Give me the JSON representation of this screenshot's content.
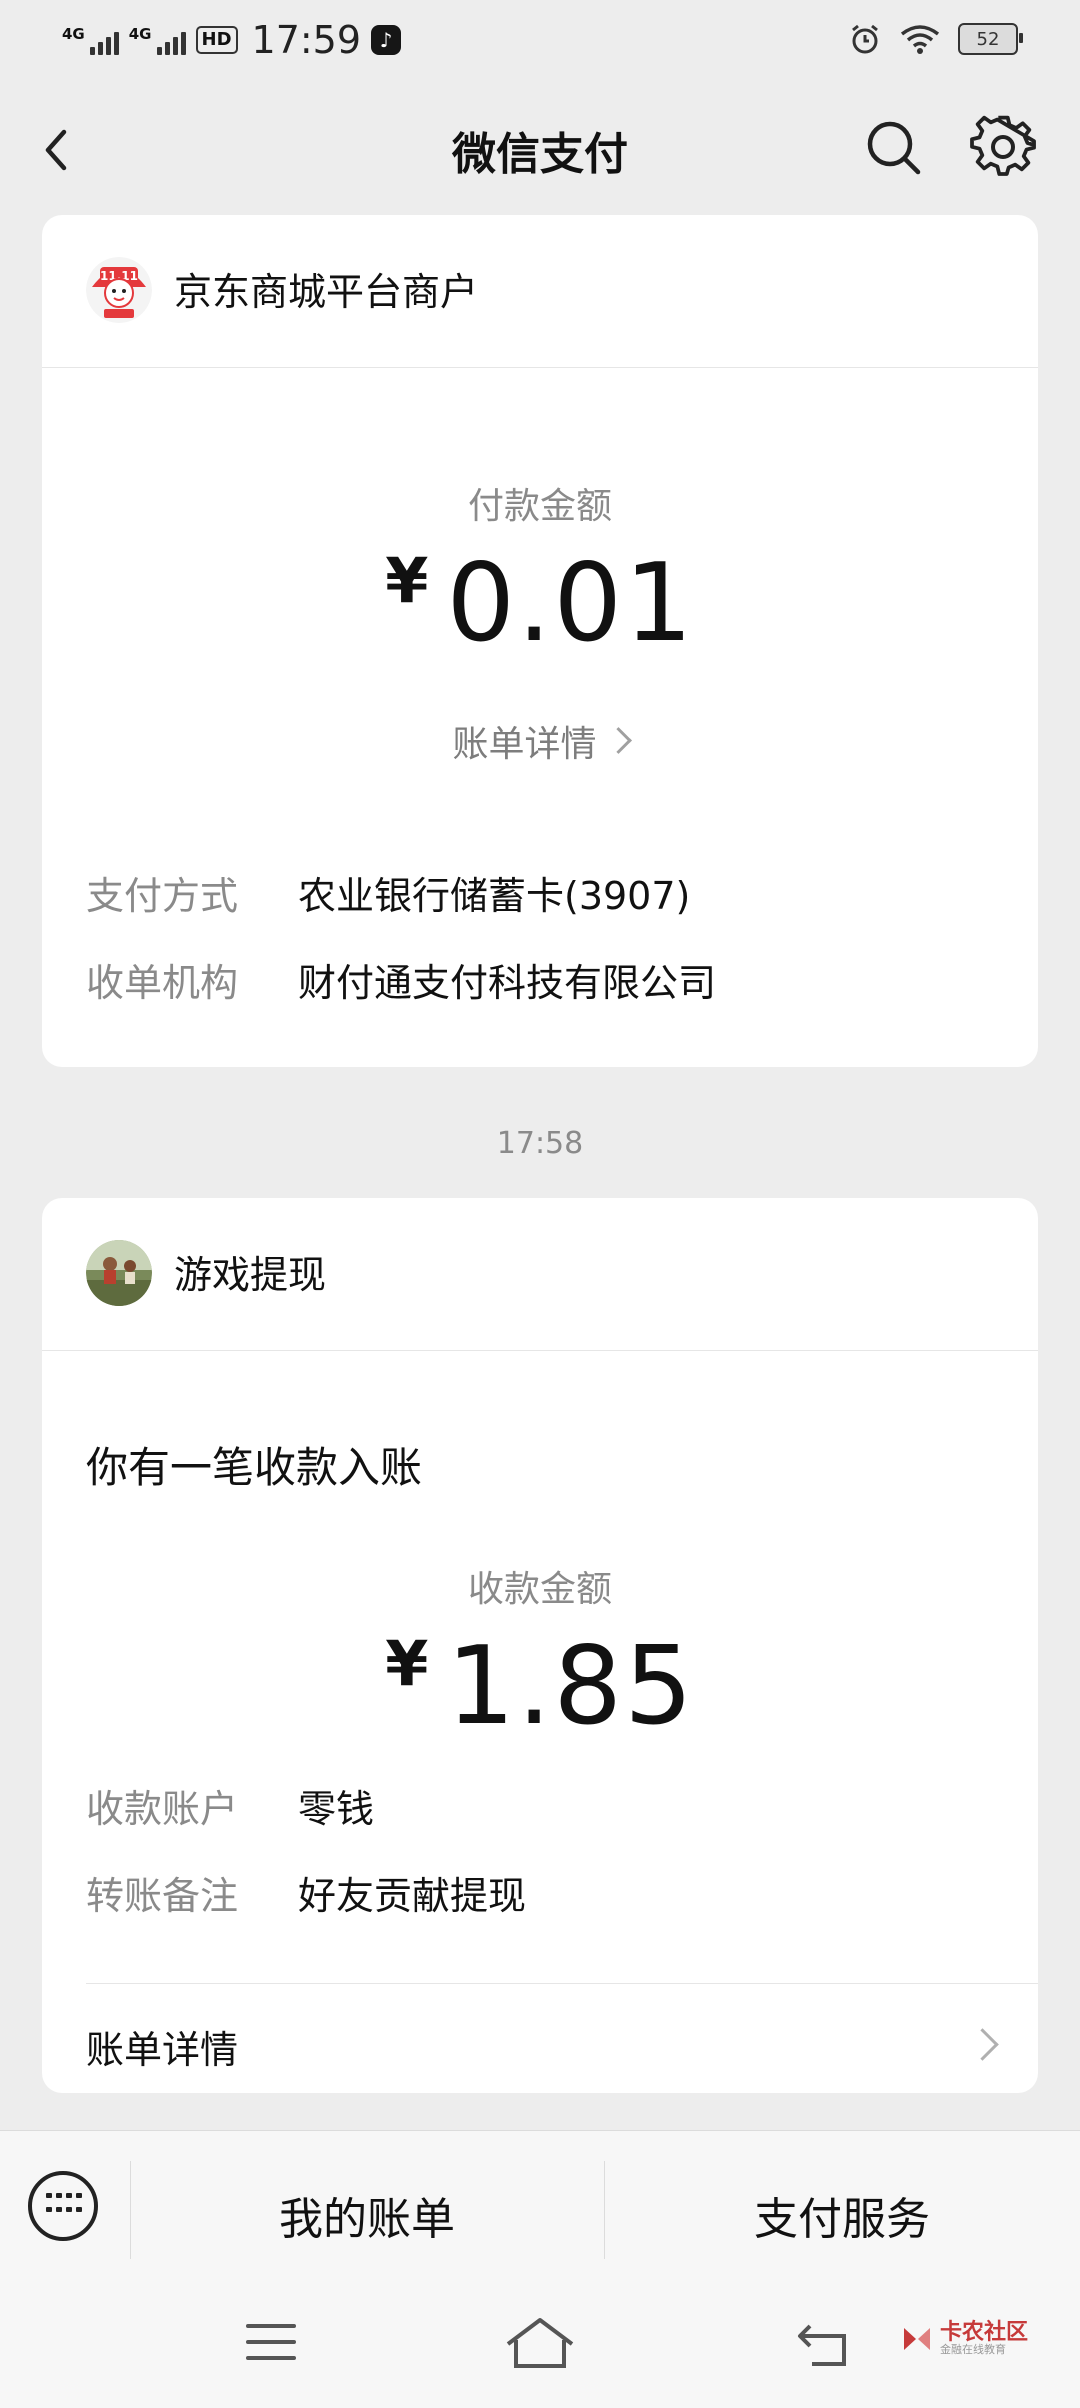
{
  "status_bar": {
    "signal1": "4G",
    "signal2": "4G",
    "hd": "HD",
    "time": "17:59",
    "battery": "52",
    "app_icon": "tiktok-icon"
  },
  "header": {
    "title": "微信支付",
    "icons": [
      "back-icon",
      "search-icon",
      "gear-icon"
    ]
  },
  "payment_card": {
    "merchant": "京东商城平台商户",
    "amount_label": "付款金额",
    "currency": "¥",
    "amount": "0.01",
    "bill_detail": "账单详情",
    "rows": [
      {
        "key": "支付方式",
        "value": "农业银行储蓄卡(3907)"
      },
      {
        "key": "收单机构",
        "value": "财付通支付科技有限公司"
      }
    ]
  },
  "timestamp": "17:58",
  "receipt_card": {
    "sender": "游戏提现",
    "message": "你有一笔收款入账",
    "amount_label": "收款金额",
    "currency": "¥",
    "amount": "1.85",
    "rows": [
      {
        "key": "收款账户",
        "value": "零钱"
      },
      {
        "key": "转账备注",
        "value": "好友贡献提现"
      }
    ],
    "bill_detail": "账单详情"
  },
  "bottom_menu": {
    "keyboard_icon": "keyboard-icon",
    "items": [
      "我的账单",
      "支付服务"
    ]
  },
  "watermark": {
    "title": "卡农社区",
    "subtitle": "金融在线教育"
  },
  "colors": {
    "background": "#ededed",
    "card": "#ffffff",
    "muted_text": "#8a8a8a",
    "jd_red": "#e4393c"
  }
}
